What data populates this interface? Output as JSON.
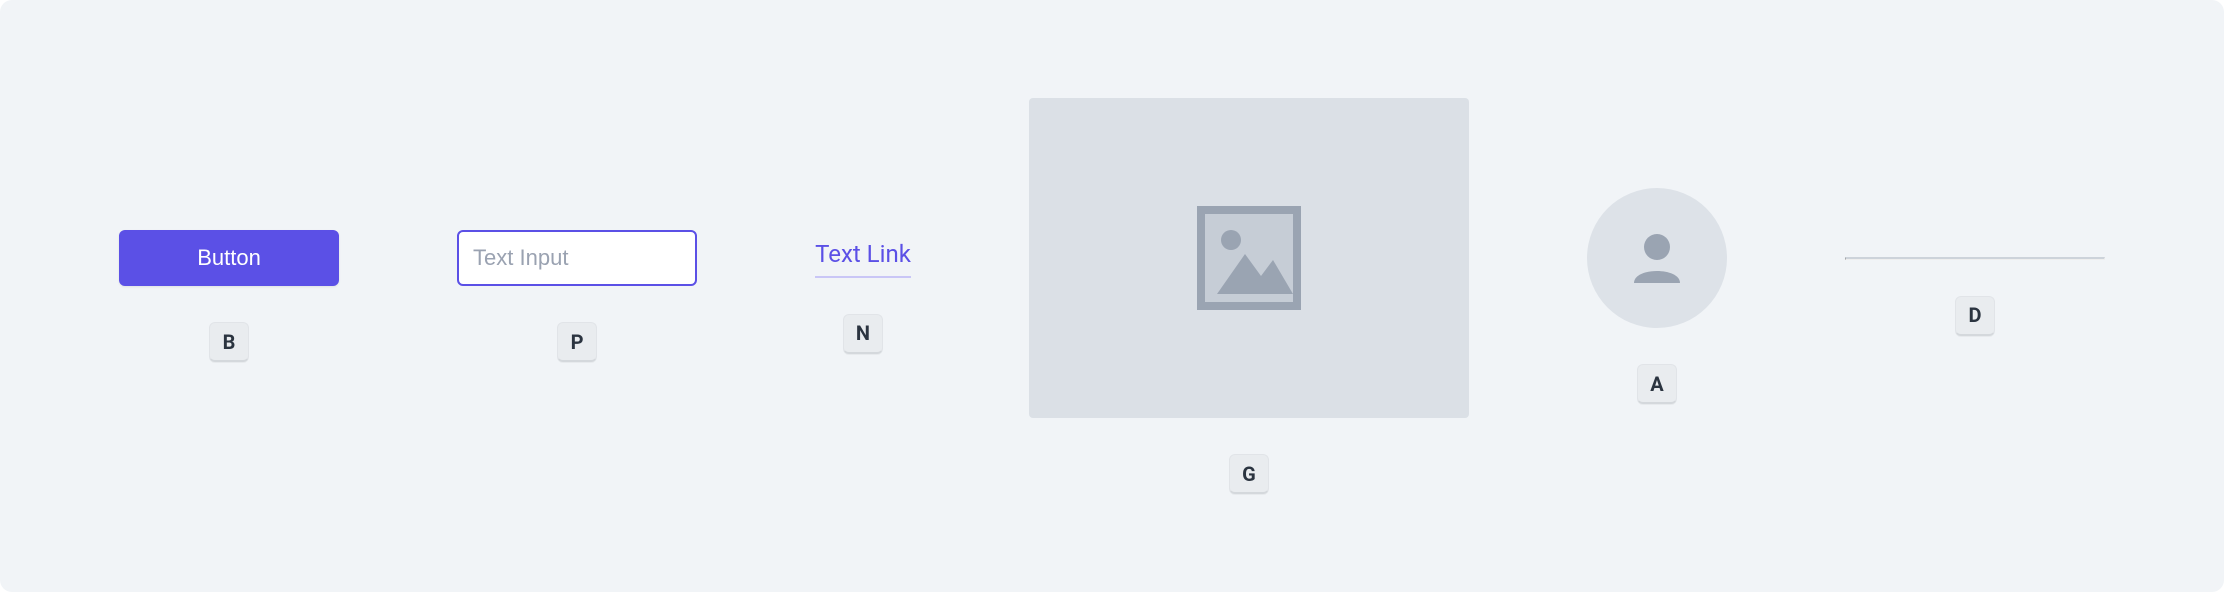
{
  "button": {
    "label": "Button",
    "key": "B"
  },
  "text_input": {
    "placeholder": "Text Input",
    "key": "P"
  },
  "text_link": {
    "label": "Text Link",
    "key": "N"
  },
  "image_placeholder": {
    "key": "G"
  },
  "avatar": {
    "key": "A"
  },
  "divider": {
    "key": "D"
  }
}
